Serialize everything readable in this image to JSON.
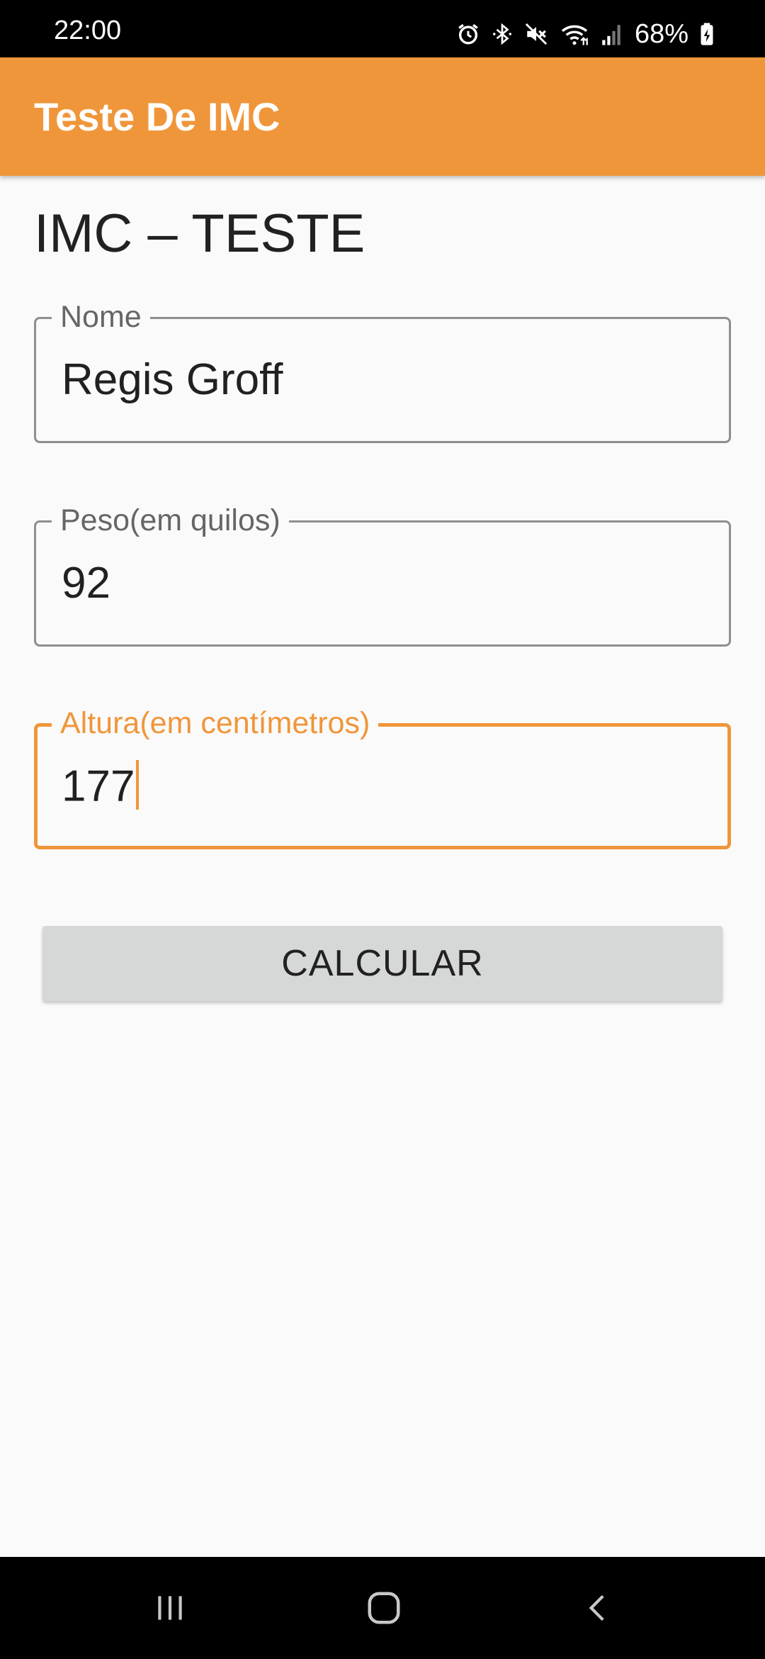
{
  "status_bar": {
    "time": "22:00",
    "battery": "68%",
    "icons": [
      "alarm-icon",
      "bluetooth-icon",
      "mute-icon",
      "wifi-icon",
      "signal-icon",
      "battery-icon"
    ]
  },
  "app_bar": {
    "title": "Teste De IMC",
    "color": "#f0963a"
  },
  "page": {
    "heading": "IMC – TESTE"
  },
  "form": {
    "name_field": {
      "label": "Nome",
      "value": "Regis Groff"
    },
    "weight_field": {
      "label": "Peso(em quilos)",
      "value": "92"
    },
    "height_field": {
      "label": "Altura(em centímetros)",
      "value": "177",
      "focused": true
    }
  },
  "actions": {
    "calculate_label": "CALCULAR"
  },
  "nav_bar": {
    "icons": [
      "recents-icon",
      "home-icon",
      "back-icon"
    ]
  }
}
